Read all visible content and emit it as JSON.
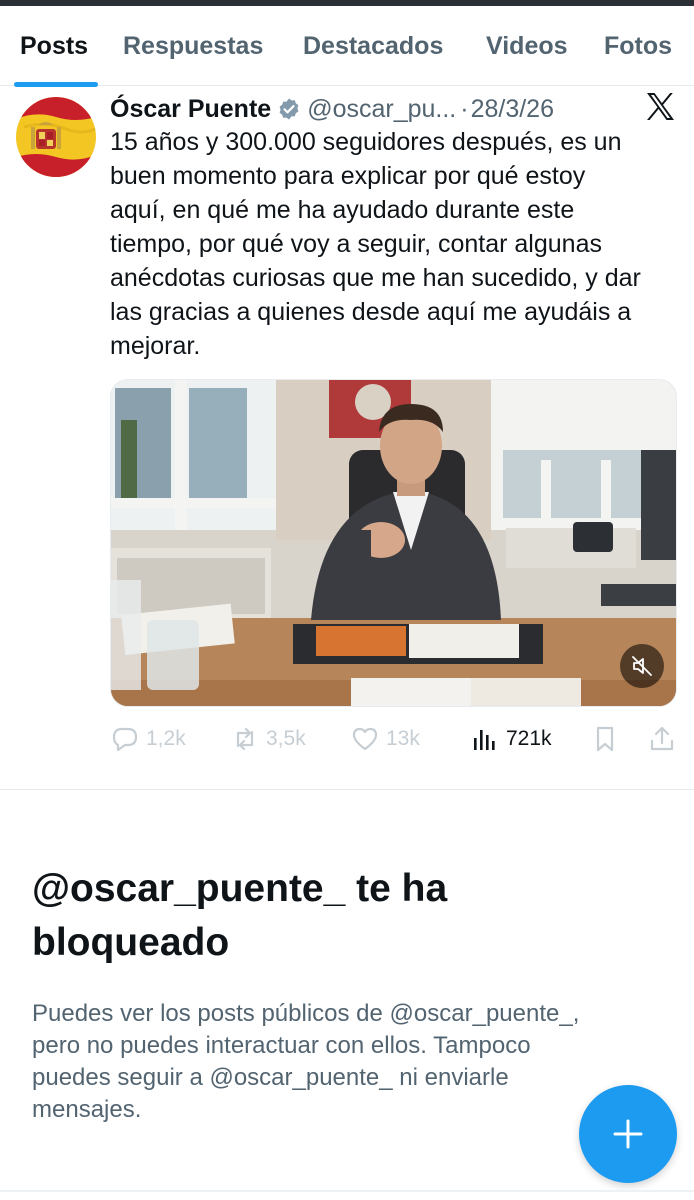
{
  "tabs": [
    {
      "label": "Posts",
      "active": true
    },
    {
      "label": "Respuestas"
    },
    {
      "label": "Destacados"
    },
    {
      "label": "Videos"
    },
    {
      "label": "Fotos"
    }
  ],
  "post": {
    "author": "Óscar Puente",
    "handle": "@oscar_pu...",
    "separator": "·",
    "date": "28/3/26",
    "text_lines": [
      "15 años y 300.000 seguidores después, es un",
      "buen momento para explicar por qué estoy",
      "aquí, en qué me ha ayudado durante este",
      "tiempo, por qué voy a seguir, contar algunas",
      "anécdotas curiosas que me han sucedido, y dar",
      "las gracias a quienes desde aquí me ayudáis a",
      "mejorar."
    ],
    "media": {
      "type": "video",
      "muted": true
    },
    "actions": {
      "replies": "1,2k",
      "reposts": "3,5k",
      "likes": "13k",
      "views": "721k"
    }
  },
  "blocked": {
    "title_lines": [
      "@oscar_puente_ te ha",
      "bloqueado"
    ],
    "desc_lines": [
      "Puedes ver los posts públicos de @oscar_puente_,",
      "pero no puedes interactuar con ellos. Tampoco",
      "puedes seguir a @oscar_puente_ ni enviarle",
      "mensajes."
    ]
  },
  "colors": {
    "accent": "#1d9bf0",
    "text_primary": "#0f1419",
    "text_secondary": "#536471",
    "icon_muted": "#c6ced4"
  },
  "icons": {
    "verified": "verified-badge-icon",
    "x_logo": "x-logo-icon",
    "reply": "reply-icon",
    "repost": "repost-icon",
    "like": "heart-icon",
    "views": "views-chart-icon",
    "bookmark": "bookmark-icon",
    "share": "share-icon",
    "mute": "speaker-muted-icon",
    "compose": "plus-icon"
  }
}
